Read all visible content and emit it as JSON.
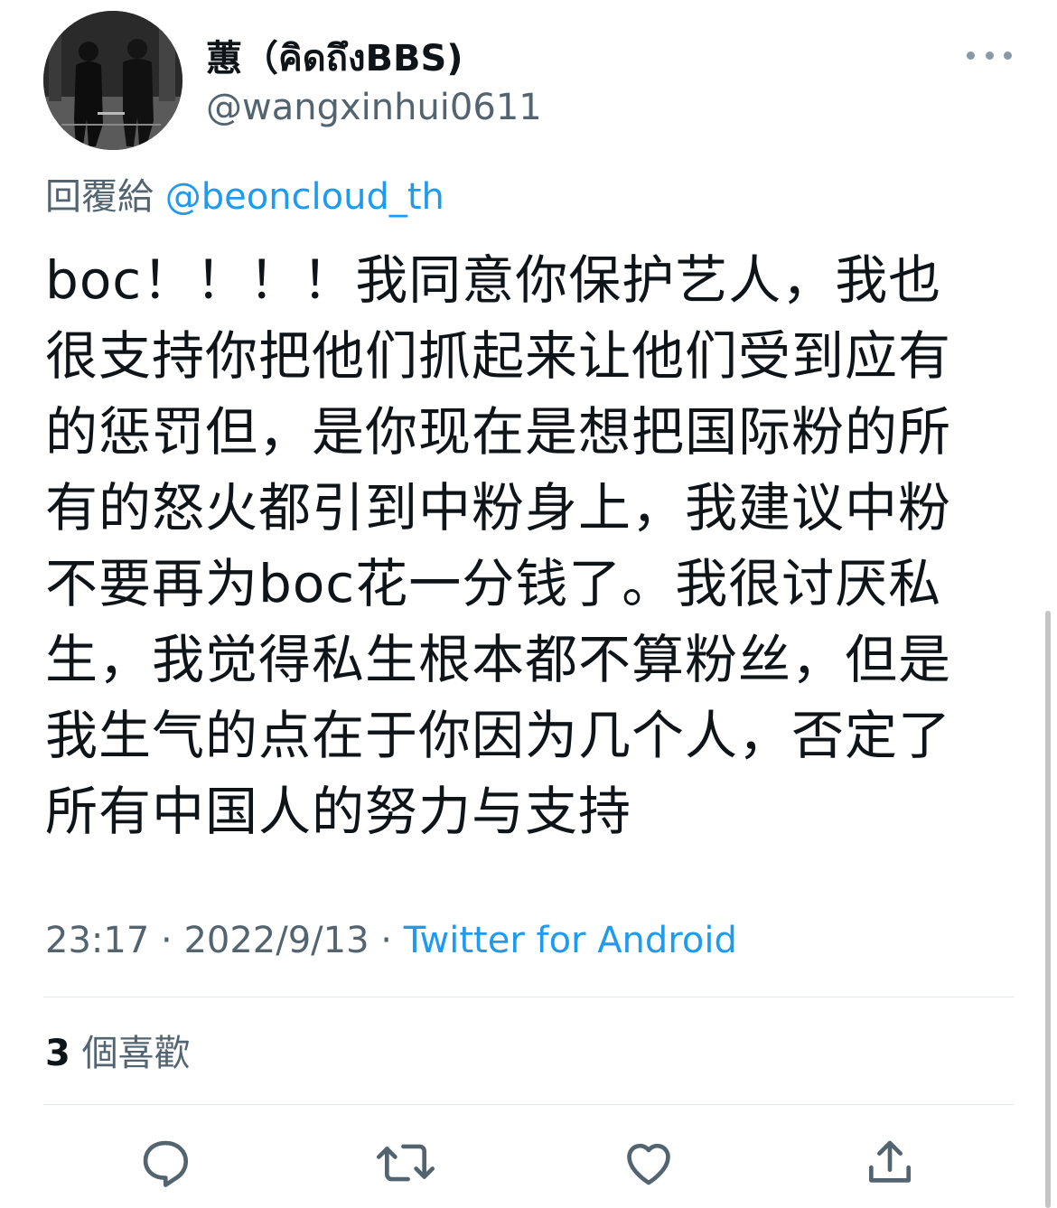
{
  "header": {
    "display_name": "蕙（คิดถึงBBS)",
    "handle": "@wangxinhui0611"
  },
  "reply": {
    "prefix": "回覆給",
    "mention": "@beoncloud_th"
  },
  "tweet": {
    "lines": [
      "boc！！！！我同意你保护艺人，我也",
      "很支持你把他们抓起来让他们受到应有",
      "的惩罚但，是你现在是想把国际粉的所",
      "有的怒火都引到中粉身上，我建议中粉",
      "不要再为boc花一分钱了。我很讨厌私",
      "生，我觉得私生根本都不算粉丝，但是",
      "我生气的点在于你因为几个人，否定了",
      "所有中国人的努力与支持"
    ]
  },
  "meta": {
    "time": "23:17",
    "separator": " · ",
    "date": "2022/9/13",
    "source": "Twitter for Android"
  },
  "stats": {
    "likes_count": "3",
    "likes_label": "個喜歡"
  },
  "actions": [
    "reply-icon",
    "retweet-icon",
    "like-icon",
    "share-icon"
  ],
  "colors": {
    "text": "#0f1419",
    "secondary": "#536471",
    "link": "#1d9bf0",
    "divider": "#e1e8ed"
  }
}
